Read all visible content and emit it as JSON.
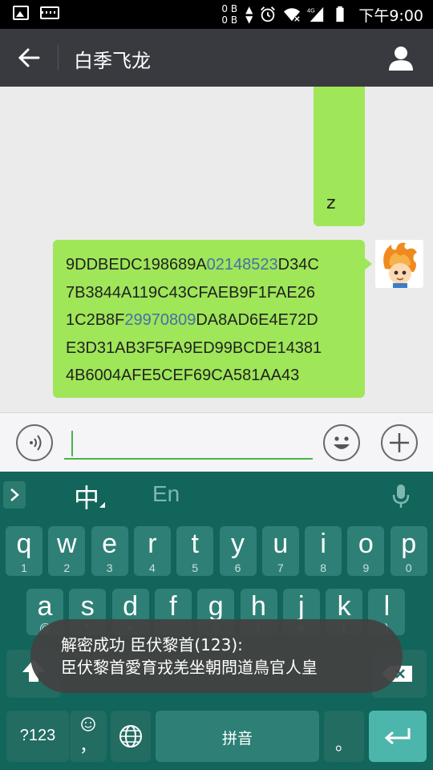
{
  "status_bar": {
    "data_up": "0 B",
    "data_down": "0 B",
    "network": "4G",
    "time": "下午9:00"
  },
  "app_bar": {
    "title": "白季飞龙"
  },
  "messages": [
    {
      "text": "z",
      "sender": "self"
    },
    {
      "sender": "self",
      "lines": [
        [
          {
            "t": "9DDBEDC198689A"
          },
          {
            "t": "02148523",
            "link": true
          },
          {
            "t": "D34C"
          }
        ],
        [
          {
            "t": "7B3844A119C43CFAEB9F1FAE26"
          }
        ],
        [
          {
            "t": "1C2B8F"
          },
          {
            "t": "29970809",
            "link": true
          },
          {
            "t": "DA8AD6E4E72D"
          }
        ],
        [
          {
            "t": "E3D31AB3F5FA9ED99BCDE14381"
          }
        ],
        [
          {
            "t": "4B6004AFE5CEF69CA581AA43"
          }
        ]
      ]
    }
  ],
  "input": {
    "value": ""
  },
  "keyboard": {
    "mode_zh": "中",
    "mode_en": "En",
    "row1": [
      {
        "k": "q",
        "s": "1"
      },
      {
        "k": "w",
        "s": "2"
      },
      {
        "k": "e",
        "s": "3"
      },
      {
        "k": "r",
        "s": "4"
      },
      {
        "k": "t",
        "s": "5"
      },
      {
        "k": "y",
        "s": "6"
      },
      {
        "k": "u",
        "s": "7"
      },
      {
        "k": "i",
        "s": "8"
      },
      {
        "k": "o",
        "s": "9"
      },
      {
        "k": "p",
        "s": "0"
      }
    ],
    "row2": [
      {
        "k": "a",
        "s": "@"
      },
      {
        "k": "s",
        "s": "*"
      },
      {
        "k": "d",
        "s": "+"
      },
      {
        "k": "f",
        "s": "-"
      },
      {
        "k": "g",
        "s": "="
      },
      {
        "k": "h",
        "s": "/"
      },
      {
        "k": "j",
        "s": "#"
      },
      {
        "k": "k",
        "s": "("
      },
      {
        "k": "l",
        "s": ")"
      }
    ],
    "num_label": "?123",
    "emoji_sub": "，",
    "space_label": "拼音",
    "period_label": "。"
  },
  "toast": {
    "line1": "解密成功 臣伏黎首(123):",
    "line2": "臣伏黎首愛育戎羌坐朝問道鳥官人皇"
  },
  "colors": {
    "bubble": "#9fe658",
    "appbar": "#393a3f",
    "keyboard": "#11655a",
    "key": "#2e8076",
    "accent": "#47b349"
  }
}
